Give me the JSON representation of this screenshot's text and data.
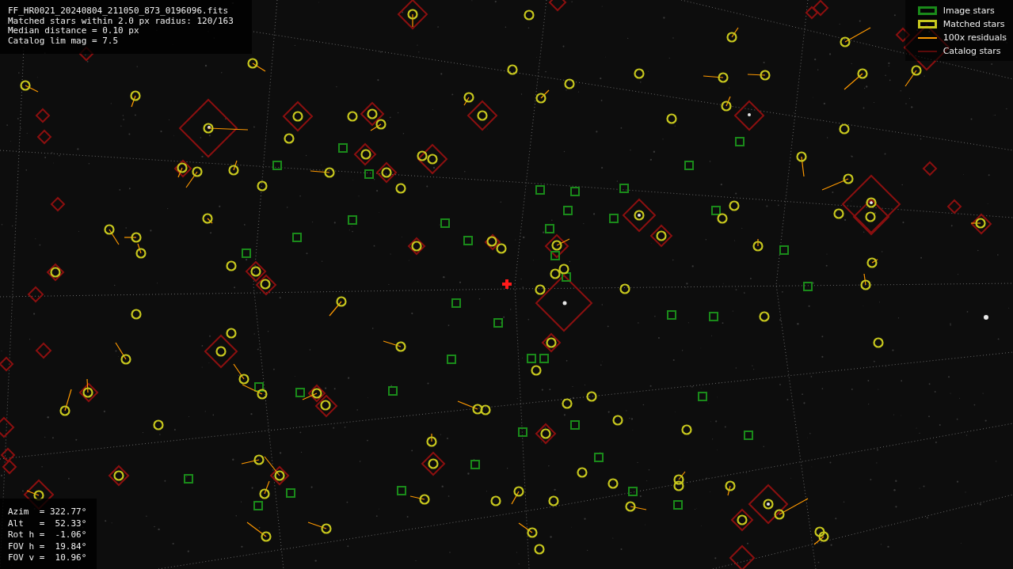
{
  "info": {
    "lines": [
      "FF_HR0021_20240804_211050_873_0196096.fits",
      "Matched stars within 2.0 px radius: 120/163",
      "Median distance = 0.10 px",
      "Catalog lim mag = 7.5"
    ]
  },
  "legend": {
    "items": [
      {
        "kind": "image",
        "label": "Image stars",
        "color": "#1a8a1a"
      },
      {
        "kind": "matched",
        "label": "Matched stars",
        "color": "#c8c81e"
      },
      {
        "kind": "residual",
        "label": "100x residuals",
        "color": "#ff9900"
      },
      {
        "kind": "catalog",
        "label": "Catalog stars",
        "color": "#5a0a0a"
      }
    ]
  },
  "pointing": {
    "lines": [
      "Azim  = 322.77°",
      "Alt   =  52.33°",
      "Rot h =  -1.06°",
      "FOV h =  19.84°",
      "FOV v =  10.96°"
    ]
  }
}
